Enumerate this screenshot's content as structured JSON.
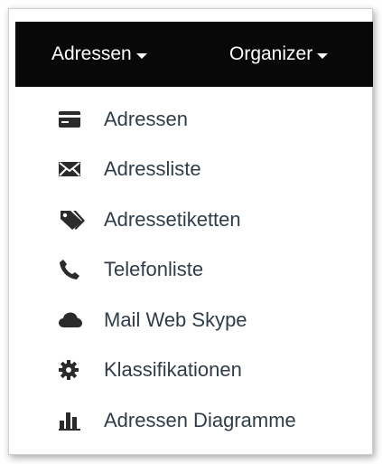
{
  "navbar": {
    "items": [
      {
        "label": "Adressen",
        "icon": "caret-down-icon"
      },
      {
        "label": "Organizer",
        "icon": "caret-down-icon"
      }
    ]
  },
  "menu": {
    "items": [
      {
        "label": "Adressen",
        "icon": "credit-card-icon"
      },
      {
        "label": "Adressliste",
        "icon": "envelope-icon"
      },
      {
        "label": "Adressetiketten",
        "icon": "tags-icon"
      },
      {
        "label": "Telefonliste",
        "icon": "phone-icon"
      },
      {
        "label": "Mail Web Skype",
        "icon": "cloud-icon"
      },
      {
        "label": "Klassifikationen",
        "icon": "cog-icon"
      },
      {
        "label": "Adressen Diagramme",
        "icon": "bar-chart-icon"
      }
    ]
  },
  "colors": {
    "navbar_bg": "#080808",
    "navbar_text": "#ffffff",
    "menu_text": "#2f3d4a",
    "icon_color": "#2b2b2b"
  }
}
